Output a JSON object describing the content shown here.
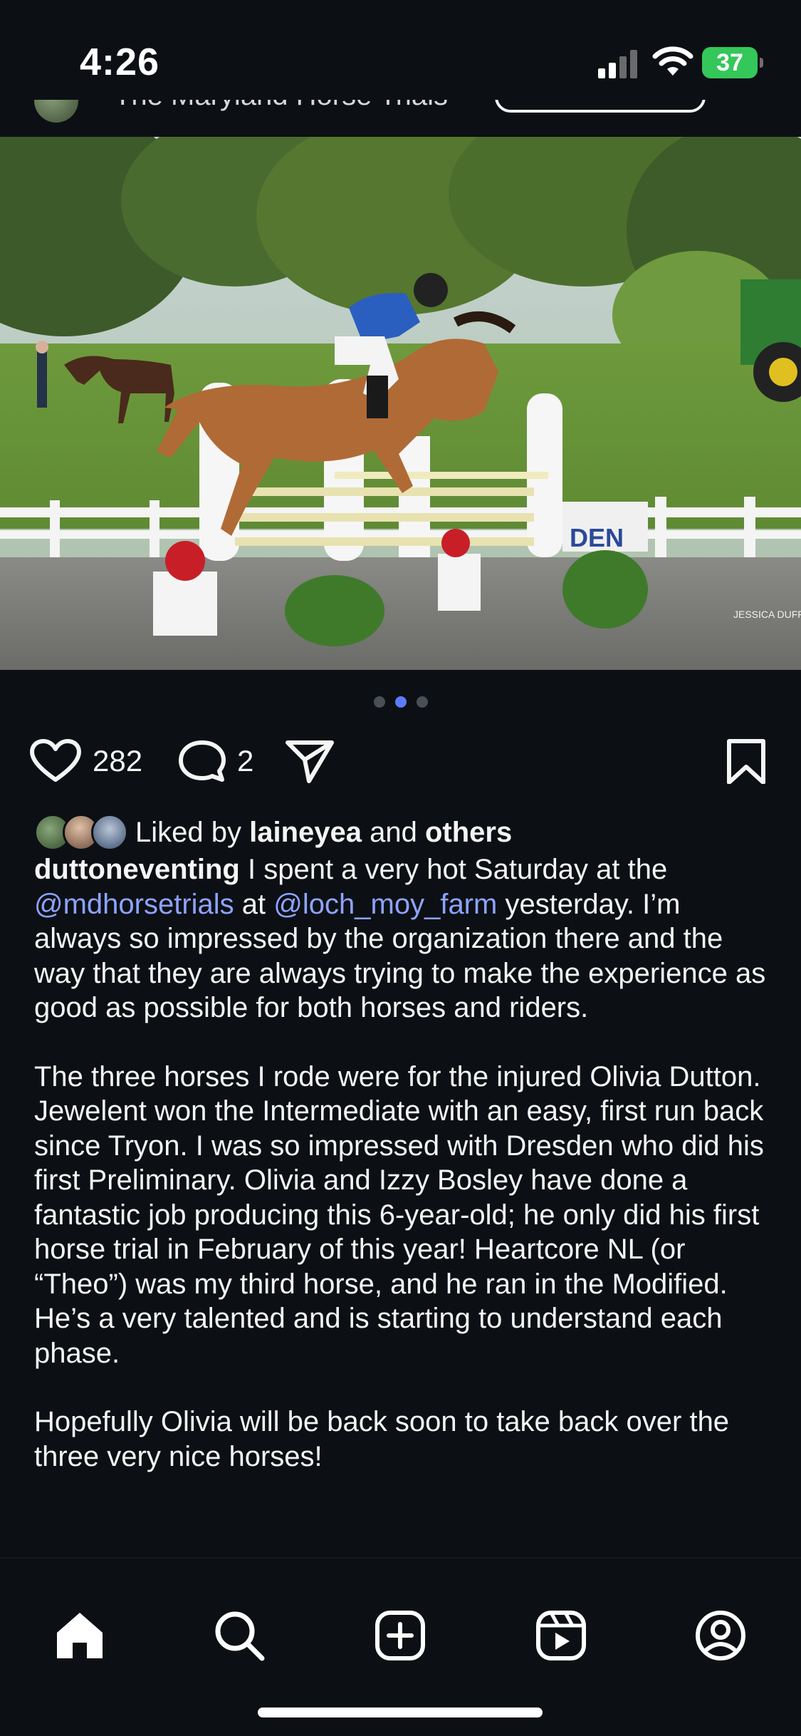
{
  "status_bar": {
    "time": "4:26",
    "battery": "37"
  },
  "header": {
    "account_name": "The Maryland Horse Trials"
  },
  "post": {
    "carousel": {
      "count": 3,
      "active_index": 1
    },
    "likes_count": "282",
    "comments_count": "2",
    "liked_by_prefix": "Liked by ",
    "liked_by_user": "laineyea",
    "liked_by_and": " and ",
    "liked_by_others": "others",
    "photo_watermark": "JESSICA DUFFY"
  },
  "caption": {
    "username": "duttoneventing",
    "p1_intro": " I spent a very hot Saturday at the ",
    "mention1": "@mdhorsetrials",
    "p1_at": " at ",
    "mention2": "@loch_moy_farm",
    "p1_rest": " yesterday. I’m always so impressed by the organization there and the way that they are always trying to make the experience as good as possible for both horses and riders.",
    "p2": "The three horses I rode were for the injured Olivia Dutton. Jewelent won the Intermediate with an easy, first run back since Tryon. I was so impressed with Dresden who did his first Preliminary. Olivia and Izzy Bosley have done a fantastic job producing this 6-year-old; he only did his first horse trial in February of this year! Heartcore NL (or “Theo”) was my third horse, and he ran in the Modified. He’s a very talented and is starting to understand each phase.",
    "p3": "Hopefully Olivia will be back soon to take back over the three very nice horses!"
  },
  "tab_bar": {
    "items": [
      "home-icon",
      "search-icon",
      "create-icon",
      "reels-icon",
      "profile-icon"
    ],
    "active": "home-icon"
  },
  "colors": {
    "background": "#0c1014",
    "mention": "#8ea3ff",
    "active_dot": "#5b7cff",
    "battery": "#34c759"
  }
}
